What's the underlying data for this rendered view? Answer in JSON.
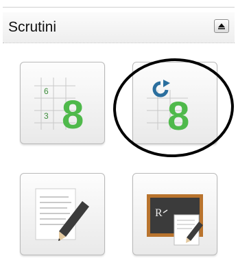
{
  "panel": {
    "title": "Scrutini",
    "collapse_icon": "collapse-up-icon"
  },
  "tiles": [
    {
      "name": "grades-grid",
      "icon": "grade-grid-8-icon",
      "glyph_small_top": "6",
      "glyph_small_bottom": "3",
      "glyph_big": "8"
    },
    {
      "name": "refresh-grades",
      "icon": "refresh-grade-8-icon",
      "glyph_big": "8"
    },
    {
      "name": "edit-document",
      "icon": "document-pencil-icon"
    },
    {
      "name": "blackboard-report",
      "icon": "blackboard-document-icon",
      "glyph_board": "R"
    }
  ],
  "annotation": {
    "highlight": "hand-drawn-ellipse"
  },
  "colors": {
    "green": "#4fb94b",
    "blue": "#2b6f9e",
    "header_bg": "#f1f1f1",
    "board": "#3b3b3b",
    "board_frame": "#b9742e"
  }
}
